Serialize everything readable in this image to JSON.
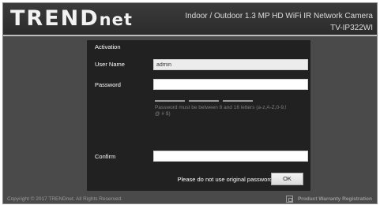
{
  "header": {
    "logo_text": "TREND",
    "logo_suffix": "net",
    "product_title": "Indoor / Outdoor 1.3 MP HD WiFi IR Network Camera",
    "model": "TV-IP322WI"
  },
  "activation": {
    "title": "Activation",
    "username_label": "User Name",
    "username_value": "admin",
    "password_label": "Password",
    "password_value": "",
    "password_hint": "Password must be between 8 and 16 letters (a-z,A-Z,0-9,! @ # $)",
    "confirm_label": "Confirm",
    "confirm_value": "",
    "notice": "Please do not use original password",
    "ok_label": "OK"
  },
  "footer": {
    "copyright": "Copyright © 2017 TRENDnet. All Rights Reserved.",
    "warranty_link": "Product Warranty Registration",
    "warranty_icon": "registration-icon"
  },
  "colors": {
    "frame": "#4a4a4a",
    "header": "#2f2f2f",
    "panel": "#212121",
    "separator": "#bdbdbd"
  }
}
